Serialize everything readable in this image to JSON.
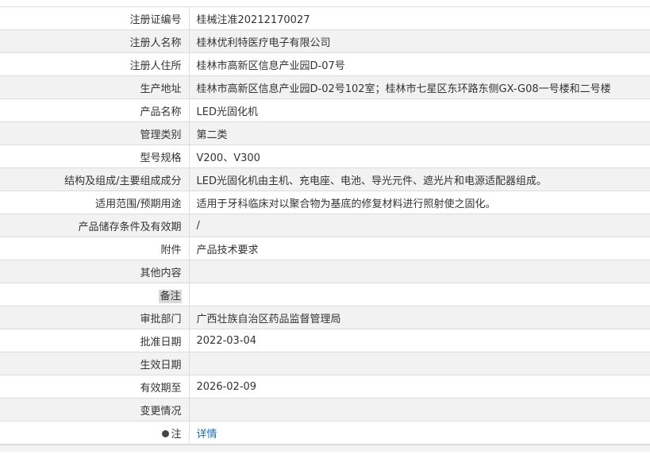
{
  "rows": [
    {
      "label": "注册证编号",
      "value": "桂械注准20212170027"
    },
    {
      "label": "注册人名称",
      "value": "桂林优利特医疗电子有限公司"
    },
    {
      "label": "注册人住所",
      "value": "桂林市高新区信息产业园D-07号"
    },
    {
      "label": "生产地址",
      "value": "桂林市高新区信息产业园D-02号102室；桂林市七星区东环路东侧GX-G08一号楼和二号楼"
    },
    {
      "label": "产品名称",
      "value": "LED光固化机"
    },
    {
      "label": "管理类别",
      "value": "第二类"
    },
    {
      "label": "型号规格",
      "value": "V200、V300"
    },
    {
      "label": "结构及组成/主要组成成分",
      "value": "LED光固化机由主机、充电座、电池、导光元件、遮光片和电源适配器组成。"
    },
    {
      "label": "适用范围/预期用途",
      "value": "适用于牙科临床对以聚合物为基底的修复材料进行照射使之固化。"
    },
    {
      "label": "产品储存条件及有效期",
      "value": "/"
    },
    {
      "label": "附件",
      "value": "产品技术要求"
    },
    {
      "label": "其他内容",
      "value": ""
    },
    {
      "label": "备注",
      "value": ""
    },
    {
      "label": "审批部门",
      "value": "广西壮族自治区药品监督管理局"
    },
    {
      "label": "批准日期",
      "value": "2022-03-04"
    },
    {
      "label": "生效日期",
      "value": ""
    },
    {
      "label": "有效期至",
      "value": "2026-02-09"
    },
    {
      "label": "变更情况",
      "value": ""
    }
  ],
  "note_row": {
    "label": "注",
    "icon": "lightbulb-icon",
    "link": "详情"
  }
}
